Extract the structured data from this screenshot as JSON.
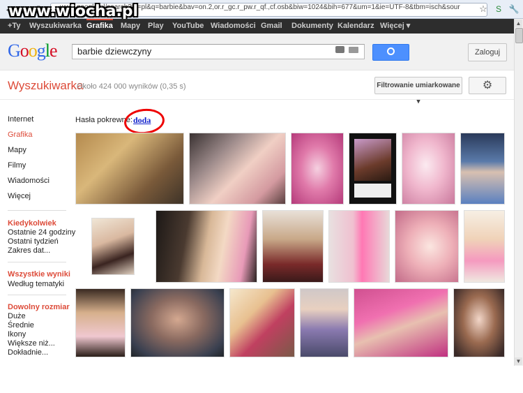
{
  "browser": {
    "url": "www.google.pl/search?hl=pl&q=barbie&bav=on.2,or.r_gc.r_pw.r_qf.,cf.osb&biw=1024&bih=677&um=1&ie=UTF-8&tbm=isch&sour",
    "watermark": "www.wiocha.pl"
  },
  "gbar": {
    "items": [
      "+Ty",
      "Wyszukiwarka",
      "Grafika",
      "Mapy",
      "Play",
      "YouTube",
      "Wiadomości",
      "Gmail",
      "Dokumenty",
      "Kalendarz",
      "Więcej ▾"
    ]
  },
  "header": {
    "search_value": "barbie dziewczyny",
    "signin_label": "Zaloguj"
  },
  "results": {
    "brand": "Wyszukiwarka",
    "stats": "Około 424 000 wyników (0,35 s)",
    "filter_label": "Filtrowanie umiarkowane",
    "related_label": "Hasła pokrewne:",
    "related_link": "doda"
  },
  "sidebar": {
    "types": [
      "Internet",
      "Grafika",
      "Mapy",
      "Filmy",
      "Wiadomości",
      "Więcej"
    ],
    "time_head": "Kiedykolwiek",
    "time_items": [
      "Ostatnie 24 godziny",
      "Ostatni tydzień",
      "Zakres dat..."
    ],
    "results_head": "Wszystkie wyniki",
    "results_items": [
      "Według tematyki"
    ],
    "size_head": "Dowolny rozmiar",
    "size_items": [
      "Duże",
      "Średnie",
      "Ikony",
      "Większe niż...",
      "Dokładnie..."
    ]
  },
  "colors": {
    "accent_red": "#dd4b39",
    "search_blue": "#4d90fe",
    "link_blue": "#1122cc",
    "gbar_bg": "#2d2d2d"
  }
}
